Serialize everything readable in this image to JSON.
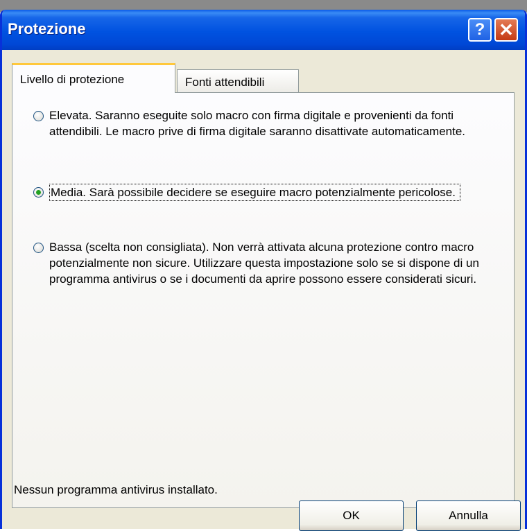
{
  "window": {
    "title": "Protezione",
    "help_glyph": "?",
    "close_glyph": "✕",
    "title_color": "#0054e3"
  },
  "tabs": [
    {
      "label": "Livello di protezione",
      "selected": true
    },
    {
      "label": "Fonti attendibili",
      "selected": false
    }
  ],
  "options": [
    {
      "label": "Elevata. Saranno eseguite solo macro con firma digitale e provenienti da fonti attendibili. Le macro prive di firma digitale saranno disattivate automaticamente.",
      "checked": false
    },
    {
      "label": "Media. Sarà possibile decidere se eseguire macro potenzialmente pericolose.",
      "checked": true
    },
    {
      "label": "Bassa (scelta non consigliata). Non verrà attivata alcuna protezione contro macro potenzialmente non sicure. Utilizzare questa impostazione solo se si dispone di un programma antivirus o se i documenti da aprire possono essere considerati sicuri.",
      "checked": false
    }
  ],
  "status": "Nessun programma antivirus installato.",
  "buttons": {
    "ok": "OK",
    "cancel": "Annulla"
  }
}
